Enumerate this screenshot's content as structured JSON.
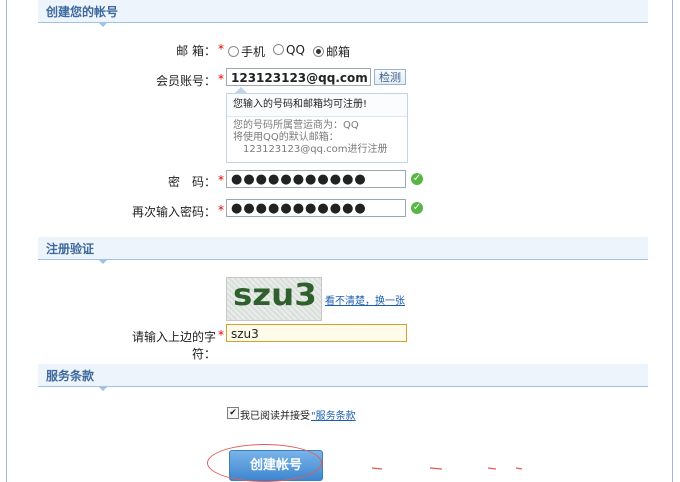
{
  "sections": {
    "account": {
      "title": "创建您的帐号"
    },
    "verify": {
      "title": "注册验证"
    },
    "terms": {
      "title": "服务条款"
    }
  },
  "form": {
    "email_label": "邮 箱：",
    "radio_options": [
      {
        "label": "手机",
        "selected": false
      },
      {
        "label": "QQ",
        "selected": false
      },
      {
        "label": "邮箱",
        "selected": true
      }
    ],
    "account_label": "会员账号：",
    "account_value": "123123123@qq.com",
    "check_button": "检测",
    "tip": {
      "headline": "您输入的号码和邮箱均可注册!",
      "lines": [
        "您的号码所属营运商为：QQ",
        "将使用QQ的默认邮箱：",
        "123123123@qq.com进行注册"
      ]
    },
    "password_label": "密　码：",
    "password_value": "●●●●●●●●●●●",
    "password_confirm_label": "再次输入密码：",
    "password_confirm_value": "●●●●●●●●●●●",
    "required_mark": "*"
  },
  "verification": {
    "captcha_text": "szu3",
    "refresh_link": "看不清楚，换一张",
    "captcha_label": "请输入上边的字符：",
    "captcha_input": "szu3"
  },
  "terms": {
    "checkbox_checked": true,
    "agree_text": "我已阅读并接受",
    "terms_link": "\"服务条款"
  },
  "submit": {
    "label": "创建帐号"
  },
  "colors": {
    "accent": "#3d6a9e",
    "valid": "#58b744",
    "required": "#e60000",
    "annotation": "#e35a5a"
  }
}
